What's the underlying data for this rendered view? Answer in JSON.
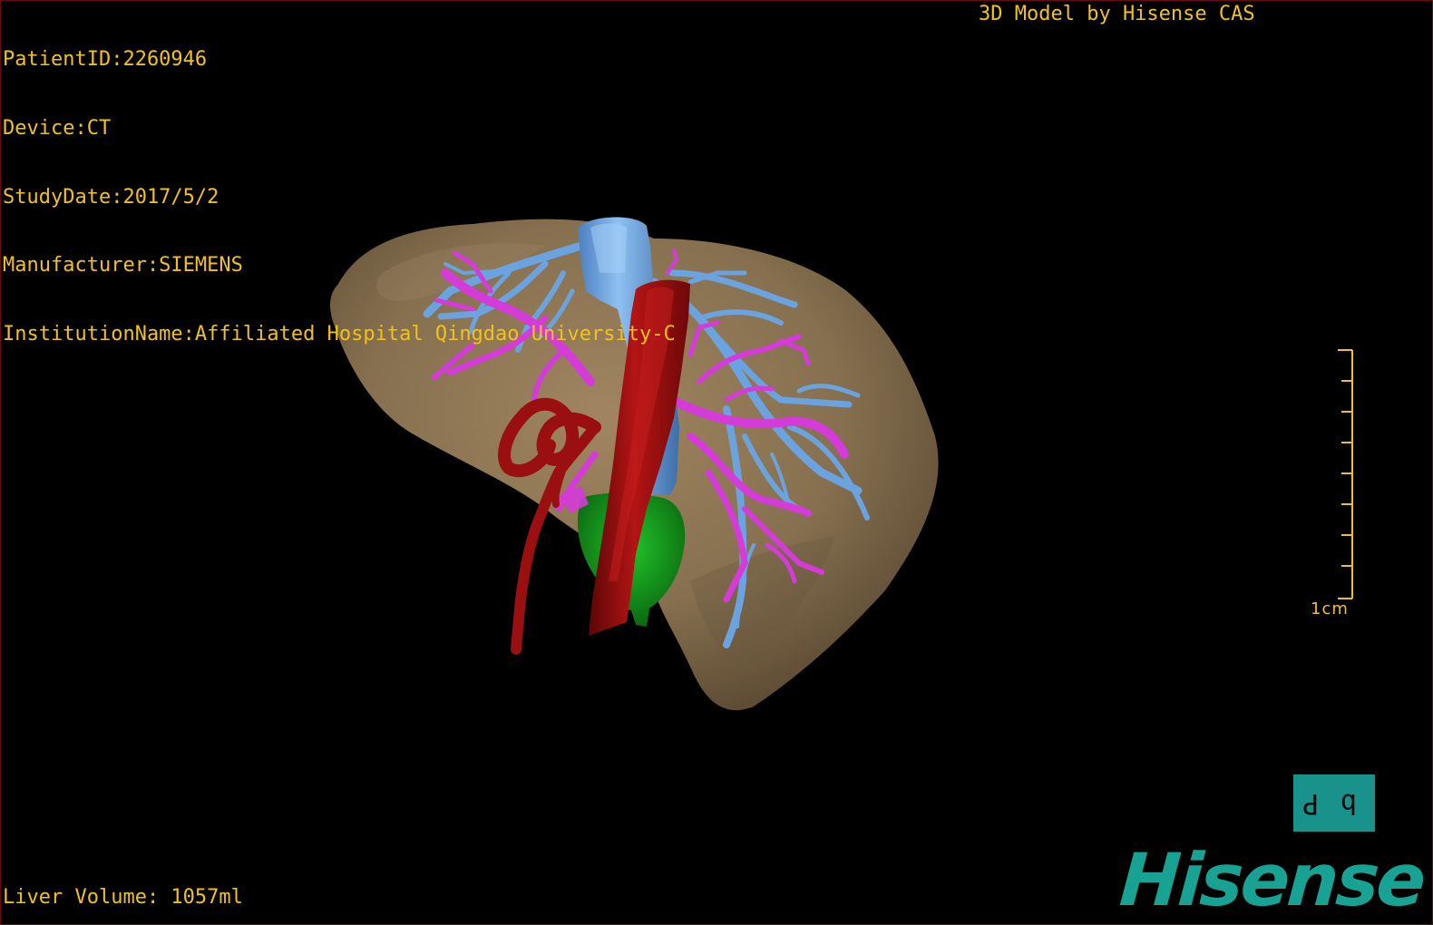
{
  "overlay": {
    "patient_id": "PatientID:2260946",
    "device": "Device:CT",
    "study_date": "StudyDate:2017/5/2",
    "manufacturer": "Manufacturer:SIEMENS",
    "institution": "InstitutionName:Affiliated Hospital Qingdao University-C",
    "model_credit": "3D Model by Hisense CAS",
    "liver_volume": "Liver Volume: 1057ml"
  },
  "scale": {
    "label": "1cm",
    "ticks": 9
  },
  "orientation": {
    "left_glyph": "P",
    "right_glyph": "d",
    "left_glyph_icon": "orientation-marker-icon"
  },
  "brand": {
    "name": "Hisense"
  },
  "colors": {
    "overlay_text": "#f2c21c",
    "liver": "#8c7353",
    "hepatic_vein": "#6aa3e0",
    "portal_vein": "#d43bd8",
    "artery": "#9a0f0f",
    "gallbladder": "#119a16",
    "brand": "#17a293"
  }
}
